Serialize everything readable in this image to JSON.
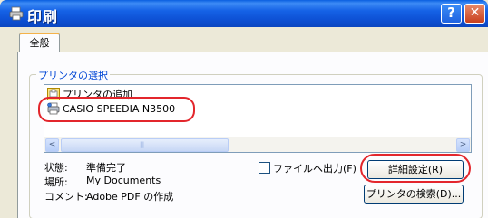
{
  "window": {
    "title": "印刷",
    "help_label": "?",
    "close_label": "✕",
    "colors": {
      "titlebar": "#0e52d6",
      "close": "#c9401d",
      "highlight": "#e3262c",
      "group_legend": "#0046d5"
    }
  },
  "tabs": [
    {
      "label": "全般",
      "active": true
    }
  ],
  "printer_group": {
    "legend": "プリンタの選択",
    "items": [
      {
        "label": "プリンタの追加",
        "icon": "add-printer-icon"
      },
      {
        "label": "CASIO SPEEDIA N3500",
        "icon": "printer-icon",
        "highlighted": true
      }
    ],
    "scrollbar": {
      "left": "<",
      "right": ">"
    }
  },
  "status": {
    "state_label": "状態:",
    "state_value": "準備完了",
    "location_label": "場所:",
    "location_value": "My Documents",
    "comment_label": "コメント:",
    "comment_value": "Adobe PDF の作成"
  },
  "print_to_file": {
    "label": "ファイルへ出力(F)",
    "checked": false
  },
  "buttons": {
    "details": "詳細設定(R)",
    "find_printer": "プリンタの検索(D)..."
  }
}
